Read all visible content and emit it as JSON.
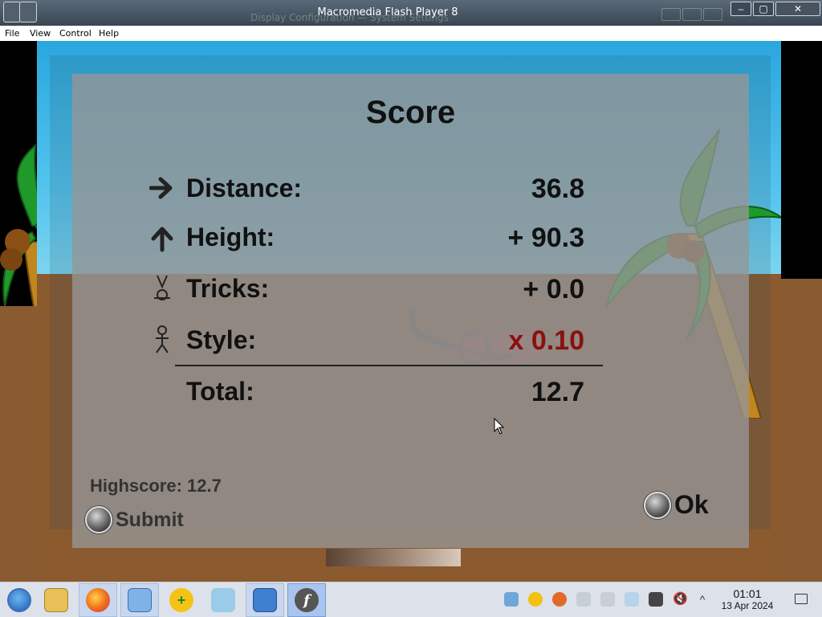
{
  "window": {
    "title": "Macromedia Flash Player 8",
    "background_window_text": "Display Configuration — System Settings",
    "controls": [
      "–",
      "▢",
      "✕"
    ]
  },
  "menu": [
    "File",
    "View",
    "Control",
    "Help"
  ],
  "score": {
    "title": "Score",
    "rows": [
      {
        "label": "Distance:",
        "value": "36.8",
        "icon": "arrow-right-icon"
      },
      {
        "label": "Height:",
        "value": "+ 90.3",
        "icon": "arrow-up-icon"
      },
      {
        "label": "Tricks:",
        "value": "+ 0.0",
        "icon": "rider-icon"
      },
      {
        "label": "Style:",
        "value": "x 0.10",
        "icon": "stick-figure-icon"
      }
    ],
    "total_label": "Total:",
    "total_value": "12.7",
    "highscore": "Highscore: 12.7",
    "submit_label": "Submit",
    "ok_label": "Ok"
  },
  "taskbar": {
    "apps": [
      "start-orb",
      "file-manager",
      "firefox",
      "system-settings",
      "app-installer",
      "cleaner",
      "archive-manager",
      "flash-player"
    ],
    "time": "01:01",
    "date": "13 Apr 2024"
  },
  "colors": {
    "sky": "#2aa7de",
    "ground": "#8b5a2f",
    "panel": "#969696",
    "style_value": "#8c0f0f",
    "taskbar": "#dde2ea"
  }
}
